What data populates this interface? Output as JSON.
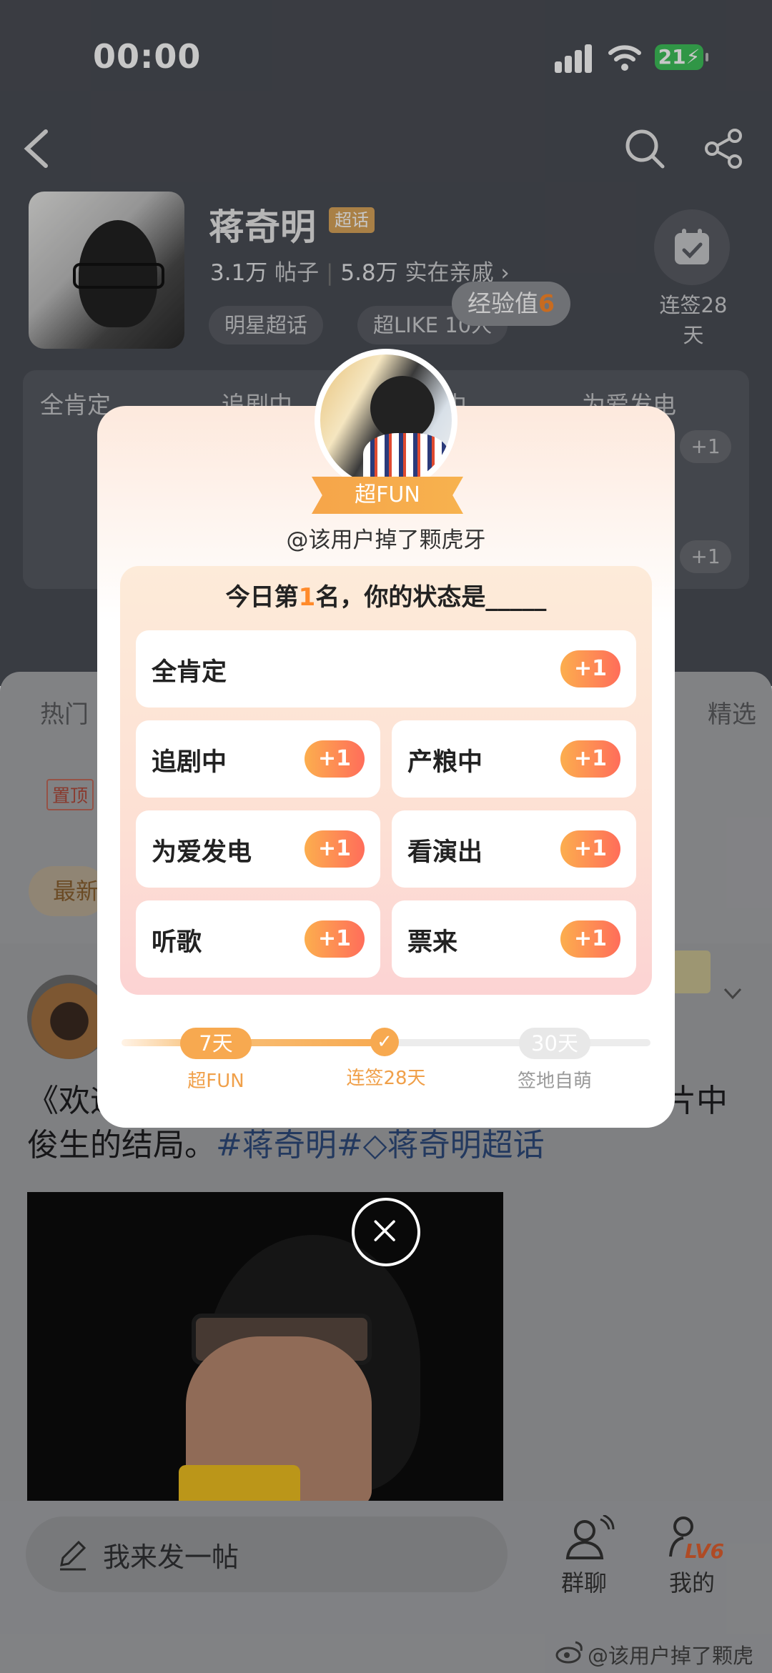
{
  "status_bar": {
    "time": "00:00",
    "battery": "21"
  },
  "profile": {
    "name": "蒋奇明",
    "tag": "超话",
    "posts_count": "3.1万",
    "posts_label": "帖子",
    "fans_count": "5.8万",
    "fans_label": "实在亲戚",
    "chips": [
      "明星超话",
      "超LIKE 10人"
    ],
    "checkin_label": "连签28天",
    "checkin_line1": "连签28",
    "checkin_line2": "天"
  },
  "exp_badge": {
    "label": "经验值",
    "value": "6"
  },
  "bg_grid": {
    "items": [
      "全肯定",
      "追剧中",
      "中",
      "为爱发电"
    ],
    "plus": "+1"
  },
  "tabs": {
    "left": "热门",
    "right": "精选"
  },
  "pinned_tag": "置顶",
  "newest_chip": "最新",
  "post": {
    "text_a": "《欢迎",
    "text_b": "片中",
    "text_line2": "俊生的结局。",
    "hashtags": "#蒋奇明#",
    "topic": "蒋奇明超话"
  },
  "modal": {
    "ribbon": "超FUN",
    "handle": "@该用户掉了颗虎牙",
    "question_pre": "今日第",
    "question_rank": "1",
    "question_post": "名，你的状态是_____",
    "options": [
      "全肯定",
      "追剧中",
      "产粮中",
      "为爱发电",
      "看演出",
      "听歌",
      "票来"
    ],
    "plus": "+1",
    "progress": {
      "left_badge": "7天",
      "left_label": "超FUN",
      "mid_label": "连签28天",
      "right_badge": "30天",
      "right_label": "签地自萌"
    }
  },
  "bottom_bar": {
    "input_placeholder": "我来发一帖",
    "group_chat": "群聊",
    "mine": "我的",
    "level": "LV6"
  },
  "watermark": "@该用户掉了颗虎牙",
  "colors": {
    "accent": "#f7a950",
    "plus_gradient_end": "#ff6d5a",
    "rank": "#ff8a2a"
  }
}
